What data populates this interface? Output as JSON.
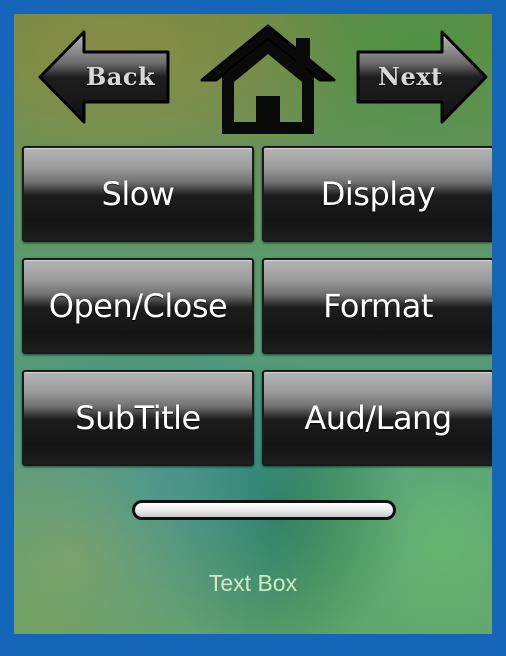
{
  "nav": {
    "back_label": "Back",
    "next_label": "Next",
    "home_icon": "home-icon"
  },
  "buttons": {
    "slow": "Slow",
    "display": "Display",
    "open_close": "Open/Close",
    "format": "Format",
    "subtitle": "SubTitle",
    "aud_lang": "Aud/Lang"
  },
  "slider": {
    "level": 0
  },
  "text_box": {
    "label": "Text Box"
  },
  "colors": {
    "frame_border": "#1565b8",
    "button_text": "#ffffff",
    "text_box": "#cfe8c8"
  }
}
